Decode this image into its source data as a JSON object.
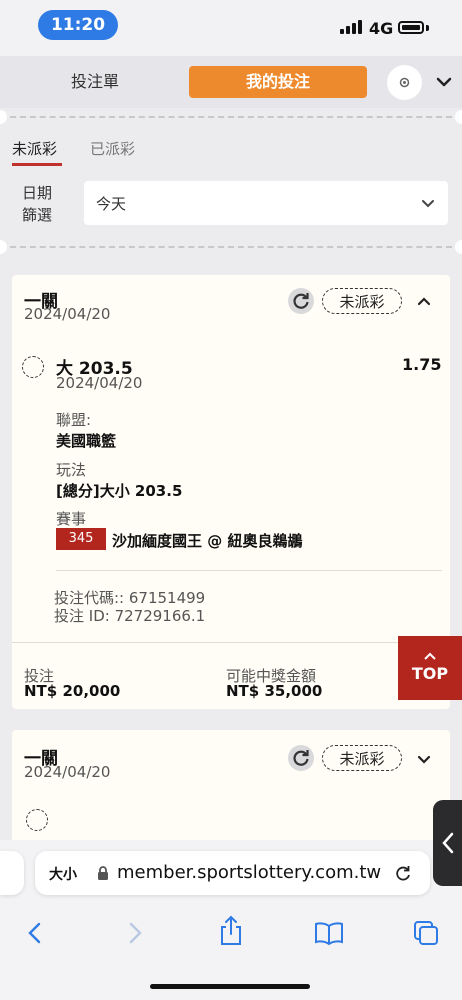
{
  "status_bar": {
    "time": "11:20",
    "network": "4G"
  },
  "header": {
    "tab_bet_slip": "投注單",
    "tab_my_bets": "我的投注",
    "settings_icon": "gear-icon",
    "menu_icon": "chevron-down-icon"
  },
  "subtabs": {
    "unsettled": "未派彩",
    "settled": "已派彩"
  },
  "filter": {
    "label_line1": "日期",
    "label_line2": "篩選",
    "value": "今天"
  },
  "bets": [
    {
      "type": "一關",
      "date": "2024/04/20",
      "status": "未派彩",
      "selection": "大 203.5",
      "selection_date": "2024/04/20",
      "odds": "1.75",
      "league_label": "聯盟:",
      "league": "美國職籃",
      "market_label": "玩法",
      "market": "[總分]大小 203.5",
      "event_label": "賽事",
      "event_id": "345",
      "event": "沙加緬度國王 @ 紐奧良鵜鶘",
      "bet_code": "投注代碼:: 67151499",
      "bet_id": "投注 ID: 72729166.1",
      "stake_label": "投注",
      "stake": "NT$ 20,000",
      "payout_label": "可能中獎金額",
      "payout": "NT$ 35,000"
    },
    {
      "type": "一關",
      "date": "2024/04/20",
      "status": "未派彩"
    }
  ],
  "top_button": {
    "label": "TOP"
  },
  "browser": {
    "text_size": "大小",
    "url": "member.sportslottery.com.tw"
  },
  "colors": {
    "accent": "#ee8a2e",
    "brand_red": "#b3261e",
    "blue": "#2f7be5"
  }
}
